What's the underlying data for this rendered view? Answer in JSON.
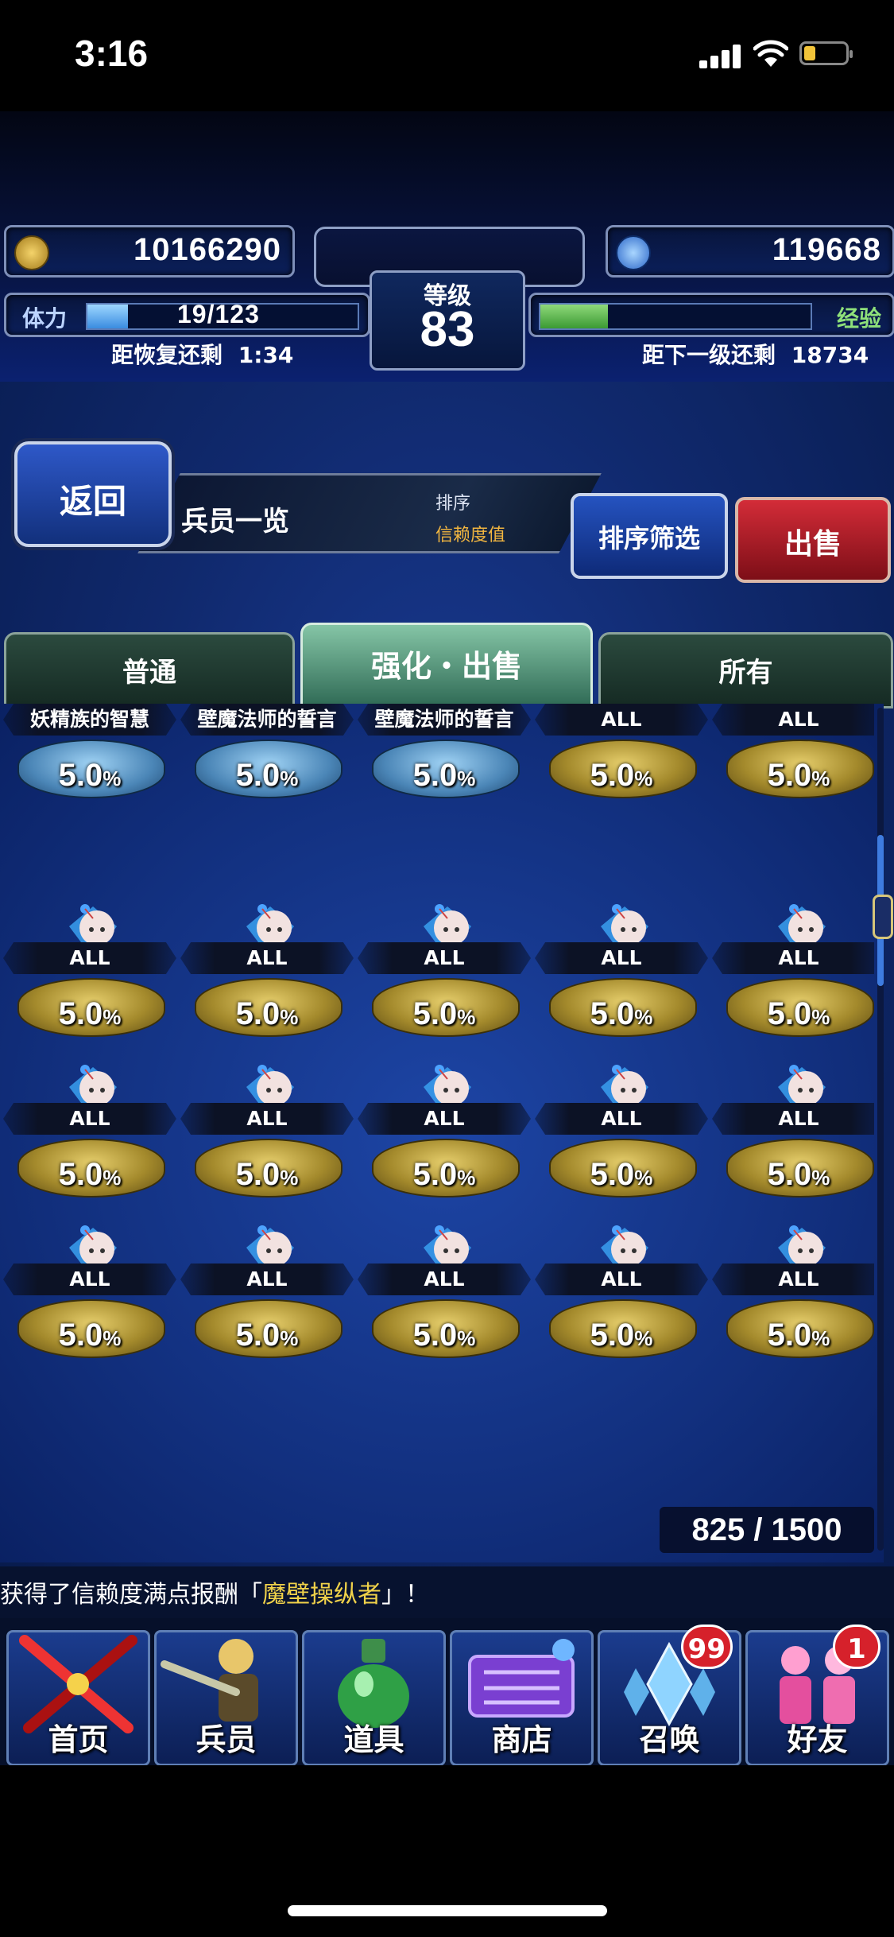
{
  "status_bar": {
    "time": "3:16",
    "icons": [
      "cellular-signal-icon",
      "wifi-icon",
      "battery-low-icon"
    ]
  },
  "header": {
    "gil": "10166290",
    "gems": "119668",
    "stamina_label": "体力",
    "stamina_value": "19/123",
    "stamina_fill": 0.15,
    "recover_label": "距恢复还剩",
    "recover_time": "1:34",
    "level_label": "等级",
    "level": "83",
    "exp_label": "经验",
    "exp_fill": 0.25,
    "next_level_label": "距下一级还剩",
    "next_level_value": "18734"
  },
  "toolbar": {
    "back_label": "返回",
    "page_title": "兵员一览",
    "sort_label": "排序",
    "sort_value": "信赖度值",
    "sort_filter_label": "排序筛选",
    "sell_label": "出售"
  },
  "tabs": [
    {
      "label": "普通",
      "active": false
    },
    {
      "label": "强化・出售",
      "active": true
    },
    {
      "label": "所有",
      "active": false
    }
  ],
  "grid": {
    "rows": [
      [
        {
          "tag": "妖精族的智慧",
          "pct": "5.0",
          "unit": "%",
          "plate": "blue"
        },
        {
          "tag": "壁魔法师的誓言",
          "pct": "5.0",
          "unit": "%",
          "plate": "blue"
        },
        {
          "tag": "壁魔法师的誓言",
          "pct": "5.0",
          "unit": "%",
          "plate": "blue"
        },
        {
          "tag": "ALL",
          "pct": "5.0",
          "unit": "%",
          "plate": "gold"
        },
        {
          "tag": "ALL",
          "pct": "5.0",
          "unit": "%",
          "plate": "gold"
        }
      ],
      [
        {
          "tag": "ALL",
          "pct": "5.0",
          "unit": "%"
        },
        {
          "tag": "ALL",
          "pct": "5.0",
          "unit": "%"
        },
        {
          "tag": "ALL",
          "pct": "5.0",
          "unit": "%"
        },
        {
          "tag": "ALL",
          "pct": "5.0",
          "unit": "%"
        },
        {
          "tag": "ALL",
          "pct": "5.0",
          "unit": "%"
        }
      ],
      [
        {
          "tag": "ALL",
          "pct": "5.0",
          "unit": "%"
        },
        {
          "tag": "ALL",
          "pct": "5.0",
          "unit": "%"
        },
        {
          "tag": "ALL",
          "pct": "5.0",
          "unit": "%"
        },
        {
          "tag": "ALL",
          "pct": "5.0",
          "unit": "%"
        },
        {
          "tag": "ALL",
          "pct": "5.0",
          "unit": "%"
        }
      ],
      [
        {
          "tag": "ALL",
          "pct": "5.0",
          "unit": "%"
        },
        {
          "tag": "ALL",
          "pct": "5.0",
          "unit": "%"
        },
        {
          "tag": "ALL",
          "pct": "5.0",
          "unit": "%"
        },
        {
          "tag": "ALL",
          "pct": "5.0",
          "unit": "%"
        },
        {
          "tag": "ALL",
          "pct": "5.0",
          "unit": "%"
        }
      ]
    ],
    "count": "825 / 1500"
  },
  "ticker": {
    "prefix": "获得了信赖度满点报酬「",
    "highlight": "魔壁操纵者",
    "suffix": "」！"
  },
  "nav": [
    {
      "label": "首页",
      "icon": "crossed-swords-icon"
    },
    {
      "label": "兵员",
      "icon": "warrior-icon"
    },
    {
      "label": "道具",
      "icon": "potion-icon"
    },
    {
      "label": "商店",
      "icon": "shop-cart-icon"
    },
    {
      "label": "召唤",
      "icon": "crystal-icon",
      "badge": "99"
    },
    {
      "label": "好友",
      "icon": "friends-icon",
      "badge": "1"
    }
  ],
  "colors": {
    "accent_gold": "#f0d24a",
    "sell_red": "#d32c38",
    "ui_blue": "#12307c"
  }
}
